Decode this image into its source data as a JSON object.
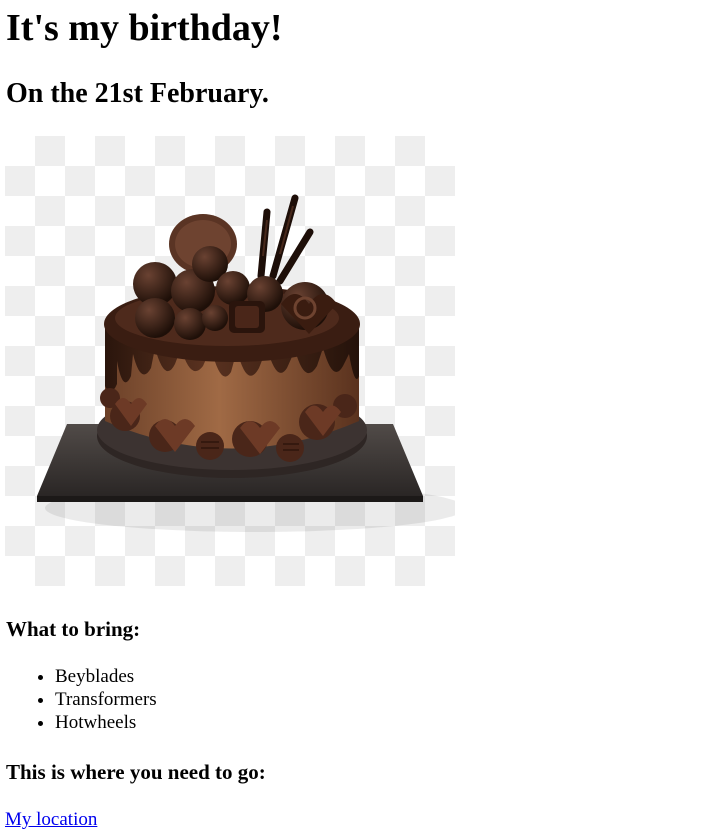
{
  "title": "It's my birthday!",
  "date_heading": "On the 21st February.",
  "image": {
    "icon": "chocolate-cake-image",
    "colors": {
      "checker_light": "#ffffff",
      "checker_dark": "#eeeeee",
      "chocolate_dark": "#2b1710",
      "chocolate_mid": "#4a2a1c",
      "sponge": "#8a5a3a",
      "board": "#3a3634"
    }
  },
  "bring": {
    "heading": "What to bring:",
    "items": [
      "Beyblades",
      "Transformers",
      "Hotwheels"
    ]
  },
  "location": {
    "heading": "This is where you need to go:",
    "link_text": "My location"
  }
}
